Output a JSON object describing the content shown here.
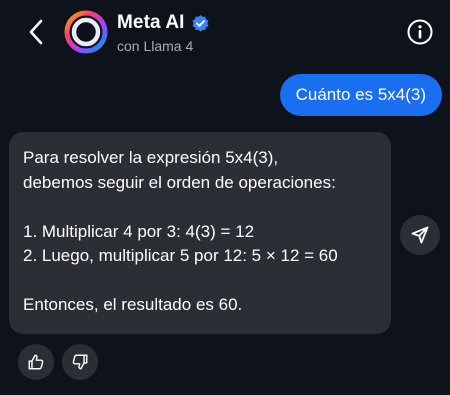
{
  "header": {
    "back_icon": "chevron-left-icon",
    "title": "Meta AI",
    "verified_icon": "verified-badge-icon",
    "subtitle": "con Llama 4",
    "info_icon": "info-circle-icon"
  },
  "messages": {
    "user": {
      "text": "Cuánto es 5x4(3)"
    },
    "ai": {
      "lines": [
        "Para resolver la expresión 5x4(3),",
        "debemos seguir el orden de operaciones:",
        "",
        "1.  Multiplicar 4 por 3: 4(3) = 12",
        "2.  Luego, multiplicar 5 por 12: 5 × 12 = 60",
        "",
        "Entonces, el resultado es 60."
      ]
    }
  },
  "actions": {
    "share_icon": "send-icon",
    "like_icon": "thumbs-up-icon",
    "dislike_icon": "thumbs-down-icon"
  },
  "colors": {
    "background": "#0e121a",
    "user_bubble": "#1a6ef0",
    "ai_bubble": "#2b2e35",
    "verified": "#3b82f6",
    "subtitle": "#a7abb2"
  }
}
